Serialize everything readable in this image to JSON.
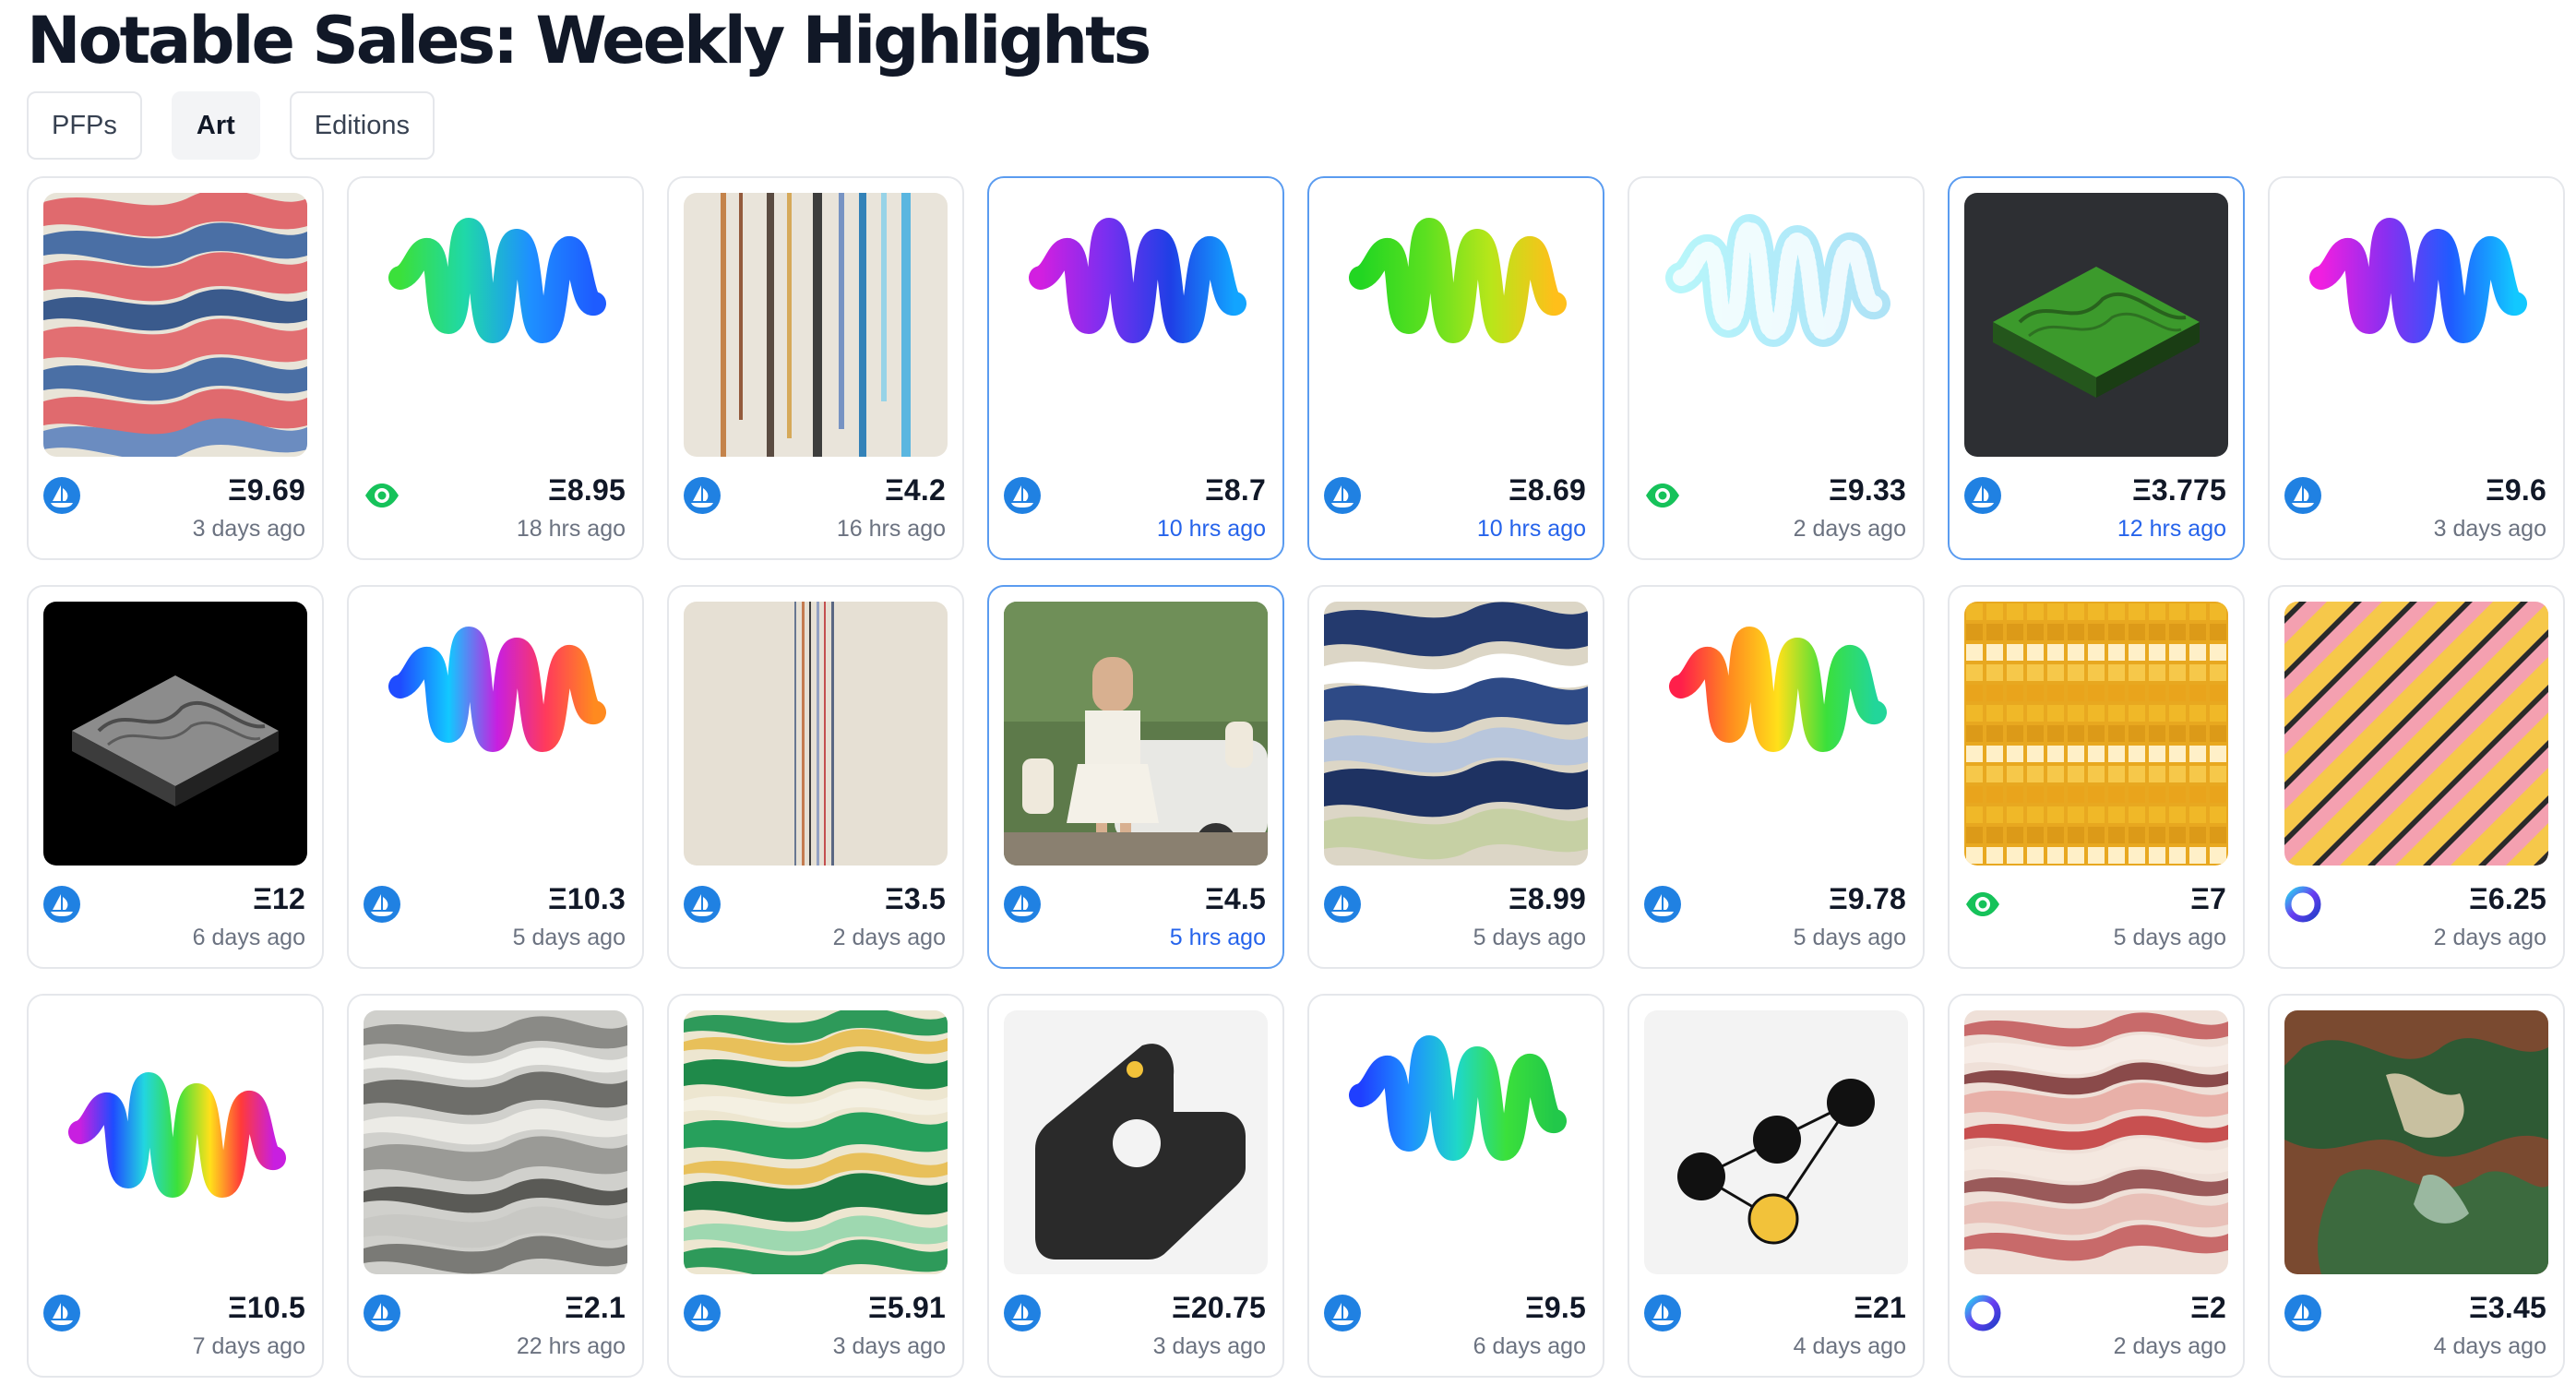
{
  "page": {
    "title": "Notable Sales: Weekly Highlights"
  },
  "tabs": [
    {
      "label": "PFPs",
      "active": false
    },
    {
      "label": "Art",
      "active": true
    },
    {
      "label": "Editions",
      "active": false
    }
  ],
  "cards": [
    {
      "art": "strata-red-blue",
      "badge": "opensea-icon",
      "price": "Ξ9.69",
      "time": "3 days ago",
      "highlight": false
    },
    {
      "art": "squiggle-green-blue",
      "badge": "eye-icon",
      "price": "Ξ8.95",
      "time": "18 hrs ago",
      "highlight": false
    },
    {
      "art": "glitch-stripes",
      "badge": "opensea-icon",
      "price": "Ξ4.2",
      "time": "16 hrs ago",
      "highlight": false
    },
    {
      "art": "squiggle-purple-blue",
      "badge": "opensea-icon",
      "price": "Ξ8.7",
      "time": "10 hrs ago",
      "highlight": true
    },
    {
      "art": "squiggle-green-yellow",
      "badge": "opensea-icon",
      "price": "Ξ8.69",
      "time": "10 hrs ago",
      "highlight": true
    },
    {
      "art": "squiggle-cyan-ghost",
      "badge": "eye-icon",
      "price": "Ξ9.33",
      "time": "2 days ago",
      "highlight": false
    },
    {
      "art": "terrain-green-iso",
      "badge": "opensea-icon",
      "price": "Ξ3.775",
      "time": "12 hrs ago",
      "highlight": true
    },
    {
      "art": "squiggle-magenta-cyan",
      "badge": "opensea-icon",
      "price": "Ξ9.6",
      "time": "3 days ago",
      "highlight": false
    },
    {
      "art": "terrain-mono-iso",
      "badge": "opensea-icon",
      "price": "Ξ12",
      "time": "6 days ago",
      "highlight": false
    },
    {
      "art": "squiggle-rainbow",
      "badge": "opensea-icon",
      "price": "Ξ10.3",
      "time": "5 days ago",
      "highlight": false
    },
    {
      "art": "thin-stripes",
      "badge": "opensea-icon",
      "price": "Ξ3.5",
      "time": "2 days ago",
      "highlight": false
    },
    {
      "art": "vintage-photo",
      "badge": "opensea-icon",
      "price": "Ξ4.5",
      "time": "5 hrs ago",
      "highlight": true
    },
    {
      "art": "strata-navy",
      "badge": "opensea-icon",
      "price": "Ξ8.99",
      "time": "5 days ago",
      "highlight": false
    },
    {
      "art": "squiggle-red-green",
      "badge": "opensea-icon",
      "price": "Ξ9.78",
      "time": "5 days ago",
      "highlight": false
    },
    {
      "art": "mosaic-yellow",
      "badge": "eye-icon",
      "price": "Ξ7",
      "time": "5 days ago",
      "highlight": false
    },
    {
      "art": "iso-pink-yellow",
      "badge": "ring-icon",
      "price": "Ξ6.25",
      "time": "2 days ago",
      "highlight": false
    },
    {
      "art": "squiggle-full-rainbow",
      "badge": "opensea-icon",
      "price": "Ξ10.5",
      "time": "7 days ago",
      "highlight": false
    },
    {
      "art": "marble-grey",
      "badge": "opensea-icon",
      "price": "Ξ2.1",
      "time": "22 hrs ago",
      "highlight": false
    },
    {
      "art": "strata-green",
      "badge": "opensea-icon",
      "price": "Ξ5.91",
      "time": "3 days ago",
      "highlight": false
    },
    {
      "art": "tag-shape",
      "badge": "opensea-icon",
      "price": "Ξ20.75",
      "time": "3 days ago",
      "highlight": false
    },
    {
      "art": "squiggle-blue-green",
      "badge": "opensea-icon",
      "price": "Ξ9.5",
      "time": "6 days ago",
      "highlight": false
    },
    {
      "art": "triangle-dots",
      "badge": "opensea-icon",
      "price": "Ξ21",
      "time": "4 days ago",
      "highlight": false
    },
    {
      "art": "marble-pink",
      "badge": "ring-icon",
      "price": "Ξ2",
      "time": "2 days ago",
      "highlight": false
    },
    {
      "art": "camo-brown",
      "badge": "opensea-icon",
      "price": "Ξ3.45",
      "time": "4 days ago",
      "highlight": false
    }
  ]
}
